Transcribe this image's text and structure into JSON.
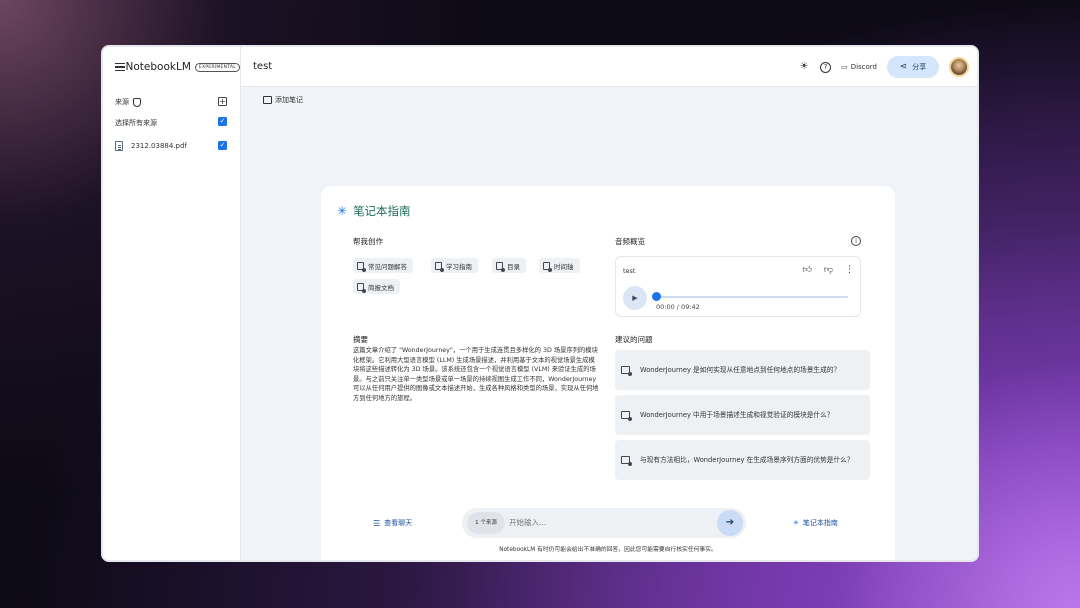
{
  "app": {
    "logo": "NotebookLM",
    "badge": "EXPERIMENTAL",
    "notebook_title": "test"
  },
  "sidebar": {
    "sources_label": "来源",
    "select_all_label": "选择所有来源",
    "files": [
      {
        "name": "2312.03884.pdf"
      }
    ]
  },
  "topbar": {
    "discord_label": "Discord",
    "share_label": "分享"
  },
  "notes": {
    "add_note_label": "添加笔记"
  },
  "guide": {
    "title": "笔记本指南",
    "help_create_label": "帮我创作",
    "chips": [
      "常见问题解答",
      "学习指南",
      "目录",
      "时间轴",
      "简报文档"
    ],
    "summary_label": "摘要",
    "summary_text": "这篇文章介绍了 \"WonderJourney\"，一个用于生成连贯且多样化的 3D 场景序列的模块化框架。它利用大型语言模型 (LLM) 生成场景描述，并利用基于文本的视觉场景生成模块将这些描述转化为 3D 场景。该系统还包含一个视觉语言模型 (VLM) 来验证生成的场景。与之前只关注单一类型场景或单一场景的持续视图生成工作不同，WonderJourney 可以从任何用户提供的图像或文本描述开始，生成各种风格和类型的场景，实现从任何地方到任何地方的旅程。",
    "audio_label": "音频概览",
    "audio": {
      "title": "test",
      "time": "00:00 / 09:42",
      "progress": 0
    },
    "suggested_label": "建议的问题",
    "questions": [
      "WonderJourney 是如何实现从任意地点到任何地点的场景生成的？",
      "WonderJourney 中用于场景描述生成和视觉验证的模块是什么？",
      "与现有方法相比，WonderJourney 在生成场景序列方面的优势是什么？"
    ]
  },
  "chat": {
    "view_chat_label": "查看聊天",
    "source_count_label": "1 个来源",
    "input_placeholder": "开始输入...",
    "guide_button_label": "笔记本指南",
    "disclaimer": "NotebookLM 有时仍可能会给出不准确的回答，因此您可能需要自行核实任何事实。"
  },
  "colors": {
    "accent": "#1a73e8",
    "guide_title": "#1e6e5a"
  }
}
